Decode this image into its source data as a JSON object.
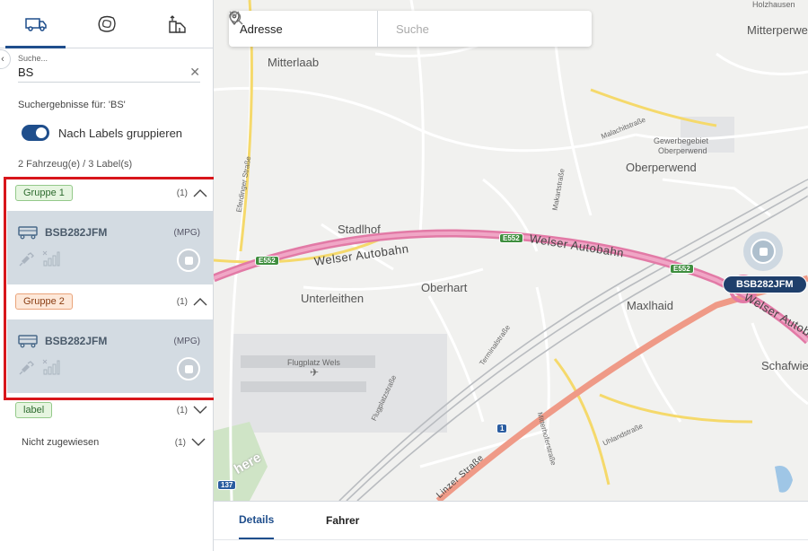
{
  "sidebar": {
    "tabs": [
      {
        "icon": "truck-icon",
        "active": true
      },
      {
        "icon": "geofence-icon",
        "active": false
      },
      {
        "icon": "route-icon",
        "active": false
      }
    ],
    "search": {
      "label": "Suche...",
      "value": "BS"
    },
    "results_for": "Suchergebnisse für: 'BS'",
    "group_toggle": {
      "label": "Nach Labels gruppieren",
      "on": true
    },
    "counts": "2 Fahrzeug(e)  /   3 Label(s)",
    "groups": [
      {
        "name": "Gruppe 1",
        "color": "green",
        "count": "(1)",
        "expanded": true,
        "vehicle": {
          "plate": "BSB282JFM",
          "type": "(MPG)"
        }
      },
      {
        "name": "Gruppe 2",
        "color": "orange",
        "count": "(1)",
        "expanded": true,
        "vehicle": {
          "plate": "BSB282JFM",
          "type": "(MPG)"
        }
      },
      {
        "name": "label",
        "color": "green",
        "count": "(1)",
        "expanded": false
      }
    ],
    "unassigned": {
      "label": "Nicht zugewiesen",
      "count": "(1)"
    }
  },
  "map": {
    "address_select": "Adresse",
    "search_placeholder": "Suche",
    "places": {
      "holzhausen": "Holzhausen",
      "mitterperwend": "Mitterperwe",
      "mitterlaab": "Mitterlaab",
      "oberperwend": "Oberperwend",
      "gewerbe1": "Gewerbegebiet",
      "gewerbe2": "Oberperwend",
      "stadlhof": "Stadlhof",
      "unterleithen": "Unterleithen",
      "oberhart": "Oberhart",
      "maxlhaid": "Maxlhaid",
      "schafwiesen": "Schafwie",
      "flugplatz": "Flugplatz Wels"
    },
    "streets": {
      "eferdinger": "Eferdinger Straße",
      "malachit": "Malachitstraße",
      "makart": "Makartstraße",
      "terminal": "Terminalstraße",
      "flugplatz": "Flugplatzstraße",
      "mitterhofer": "Mitterhoferstraße",
      "uhland": "Uhlandstraße",
      "linzer": "Linzer Straße"
    },
    "motorway": {
      "label_left": "Welser Autobahn",
      "label_right": "Welser Autobahn",
      "label_far": "Welser Autobahn"
    },
    "shields": {
      "e552": "E552",
      "b1": "1",
      "b137": "137"
    },
    "vehicle_label": "BSB282JFM",
    "here_logo": "here"
  },
  "bottom_tabs": [
    {
      "label": "Details",
      "active": true
    },
    {
      "label": "Fahrer",
      "active": false
    }
  ],
  "colors": {
    "accent": "#1f4e8c",
    "highlight": "#d8161b",
    "motorway": "#e27aa6",
    "main_road": "#ef9a87"
  }
}
